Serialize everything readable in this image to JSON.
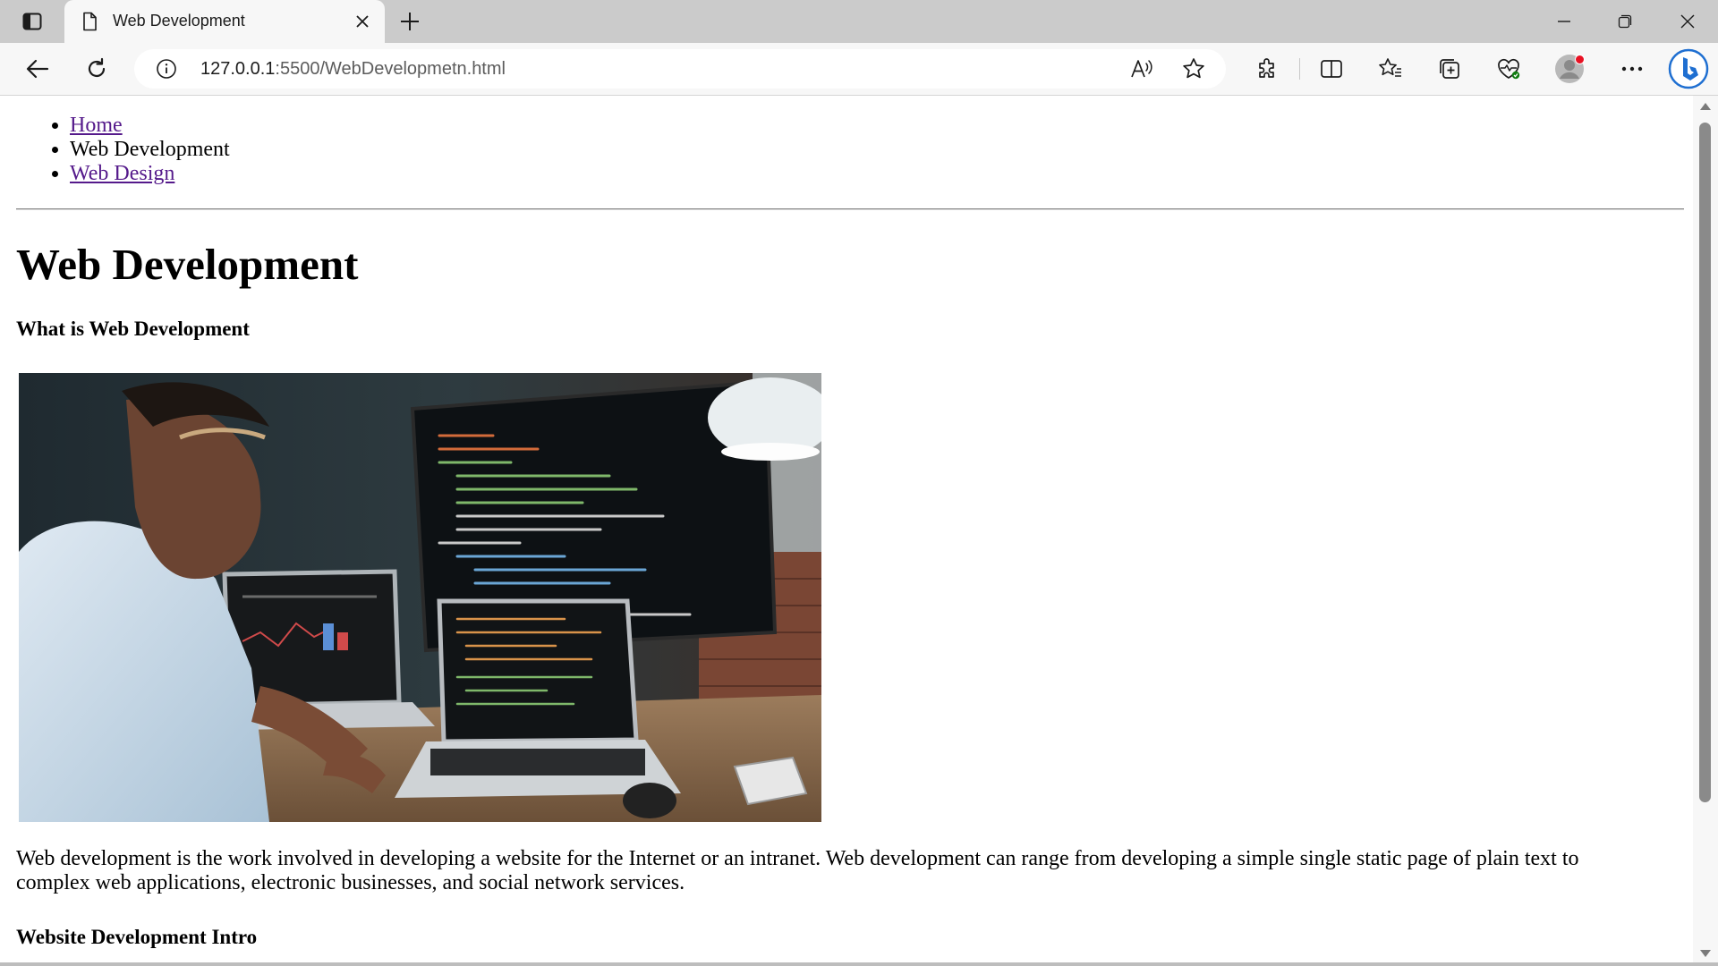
{
  "browser": {
    "tab": {
      "title": "Web Development"
    },
    "address": {
      "host": "127.0.0.1",
      "path": ":5500/WebDevelopmetn.html"
    },
    "icons": {
      "tab_actions": "vertical-tabs-icon",
      "favicon": "page-icon",
      "close": "close-icon",
      "new_tab": "plus-icon",
      "back": "back-arrow-icon",
      "refresh": "refresh-icon",
      "info": "info-icon",
      "read_aloud": "read-aloud-icon",
      "favorite": "star-icon",
      "extensions": "puzzle-icon",
      "split": "split-screen-icon",
      "favorites": "favorites-icon",
      "collections": "collections-icon",
      "performance": "heart-pulse-icon",
      "profile": "avatar-icon",
      "more": "more-icon",
      "copilot": "bing-icon"
    }
  },
  "page": {
    "nav": [
      {
        "label": "Home",
        "link": true
      },
      {
        "label": "Web Development",
        "link": false
      },
      {
        "label": "Web Design",
        "link": true
      }
    ],
    "heading": "Web Development",
    "subheading": "What is Web Development",
    "hero_image": "photo-developer-at-desk-with-monitors",
    "paragraph": "Web development is the work involved in developing a website for the Internet or an intranet. Web development can range from developing a simple single static page of plain text to complex web applications, electronic businesses, and social network services.",
    "section_heading": "Website Development Intro",
    "link_color": "#551a8b"
  }
}
